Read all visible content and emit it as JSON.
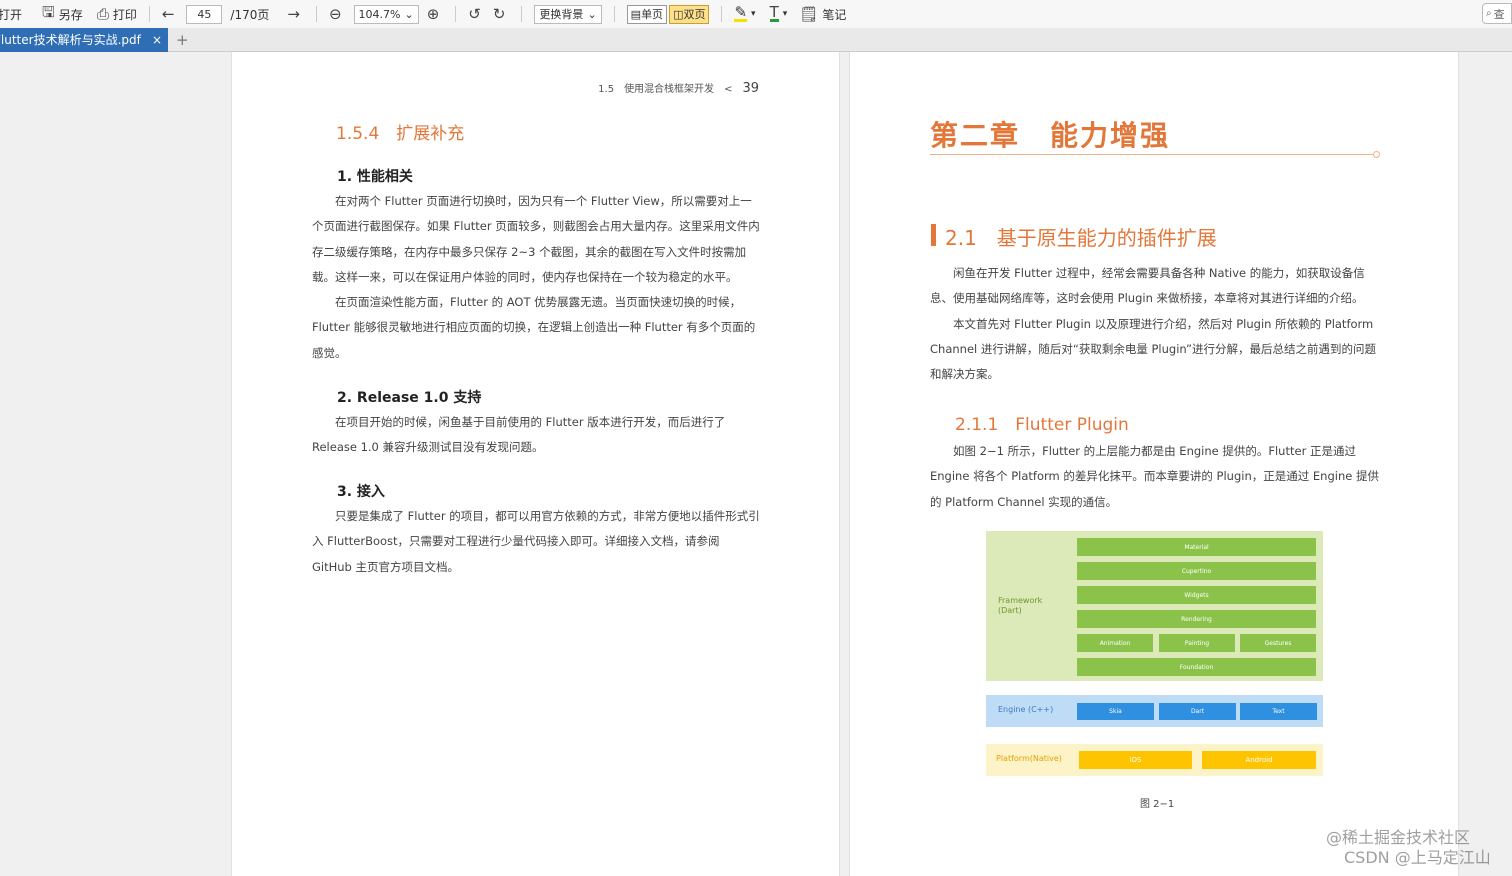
{
  "toolbar": {
    "open": "打开",
    "save_as": "另存",
    "print": "打印",
    "page_current": "45",
    "page_total": "/170页",
    "zoom": "104.7%",
    "background": "更换背景",
    "single_page": "单页",
    "double_page": "双页",
    "notes": "笔记",
    "search_placeholder": "查"
  },
  "tab": {
    "title": "Flutter技术解析与实战.pdf",
    "close": "×",
    "add": "+"
  },
  "left_page": {
    "running_head_section": "1.5",
    "running_head_title": "使用混合栈框架开发",
    "running_head_sep": "<",
    "page_number": "39",
    "section_title": "1.5.4　扩展补充",
    "sub1_title": "1.  性能相关",
    "sub1_p1": "在对两个 Flutter 页面进行切换时，因为只有一个 Flutter View，所以需要对上一个页面进行截图保存。如果 Flutter 页面较多，则截图会占用大量内存。这里采用文件内存二级缓存策略，在内存中最多只保存 2~3 个截图，其余的截图在写入文件时按需加载。这样一来，可以在保证用户体验的同时，使内存也保持在一个较为稳定的水平。",
    "sub1_p2": "在页面渲染性能方面，Flutter 的 AOT 优势展露无遗。当页面快速切换的时候，Flutter 能够很灵敏地进行相应页面的切换，在逻辑上创造出一种 Flutter 有多个页面的感觉。",
    "sub2_title": "2.  Release 1.0 支持",
    "sub2_p1": "在项目开始的时候，闲鱼基于目前使用的 Flutter 版本进行开发，而后进行了 Release 1.0 兼容升级测试目没有发现问题。",
    "sub3_title": "3.  接入",
    "sub3_p1": "只要是集成了 Flutter 的项目，都可以用官方依赖的方式，非常方便地以插件形式引入 FlutterBoost，只需要对工程进行少量代码接入即可。详细接入文档，请参阅 GitHub 主页官方项目文档。"
  },
  "right_page": {
    "chapter_title": "第二章　能力增强",
    "section_title": "2.1　基于原生能力的插件扩展",
    "p1": "闲鱼在开发 Flutter 过程中，经常会需要具备各种 Native 的能力，如获取设备信息、使用基础网络库等，这时会使用 Plugin 来做桥接，本章将对其进行详细的介绍。",
    "p2": "本文首先对 Flutter Plugin 以及原理进行介绍，然后对 Plugin 所依赖的 Platform Channel 进行讲解，随后对“获取剩余电量 Plugin”进行分解，最后总结之前遇到的问题和解决方案。",
    "subsection_title": "2.1.1　Flutter Plugin",
    "p3": "如图 2−1 所示，Flutter 的上层能力都是由 Engine 提供的。Flutter 正是通过 Engine 将各个 Platform 的差异化抹平。而本章要讲的 Plugin，正是通过 Engine 提供的 Platform Channel 实现的通信。",
    "figure": {
      "framework_label": "Framework\n(Dart)",
      "framework_bars": [
        "Material",
        "Cupertino",
        "Widgets",
        "Rendering"
      ],
      "framework_row": [
        "Animation",
        "Painting",
        "Gestures"
      ],
      "framework_base": "Foundation",
      "engine_label": "Engine (C++)",
      "engine_bars": [
        "Skia",
        "Dart",
        "Text"
      ],
      "platform_label": "Platform(Native)",
      "platform_bars": [
        "iOS",
        "Android"
      ],
      "caption": "图 2−1"
    }
  },
  "watermark": {
    "line1": "@稀土掘金技术社区",
    "line2": "CSDN @上马定江山"
  },
  "colors": {
    "accent_orange": "#e3773a",
    "tab_blue": "#2f6db5",
    "framework_green": "#8bc34a",
    "engine_blue": "#2f8fe0",
    "platform_yellow": "#ffc400"
  }
}
